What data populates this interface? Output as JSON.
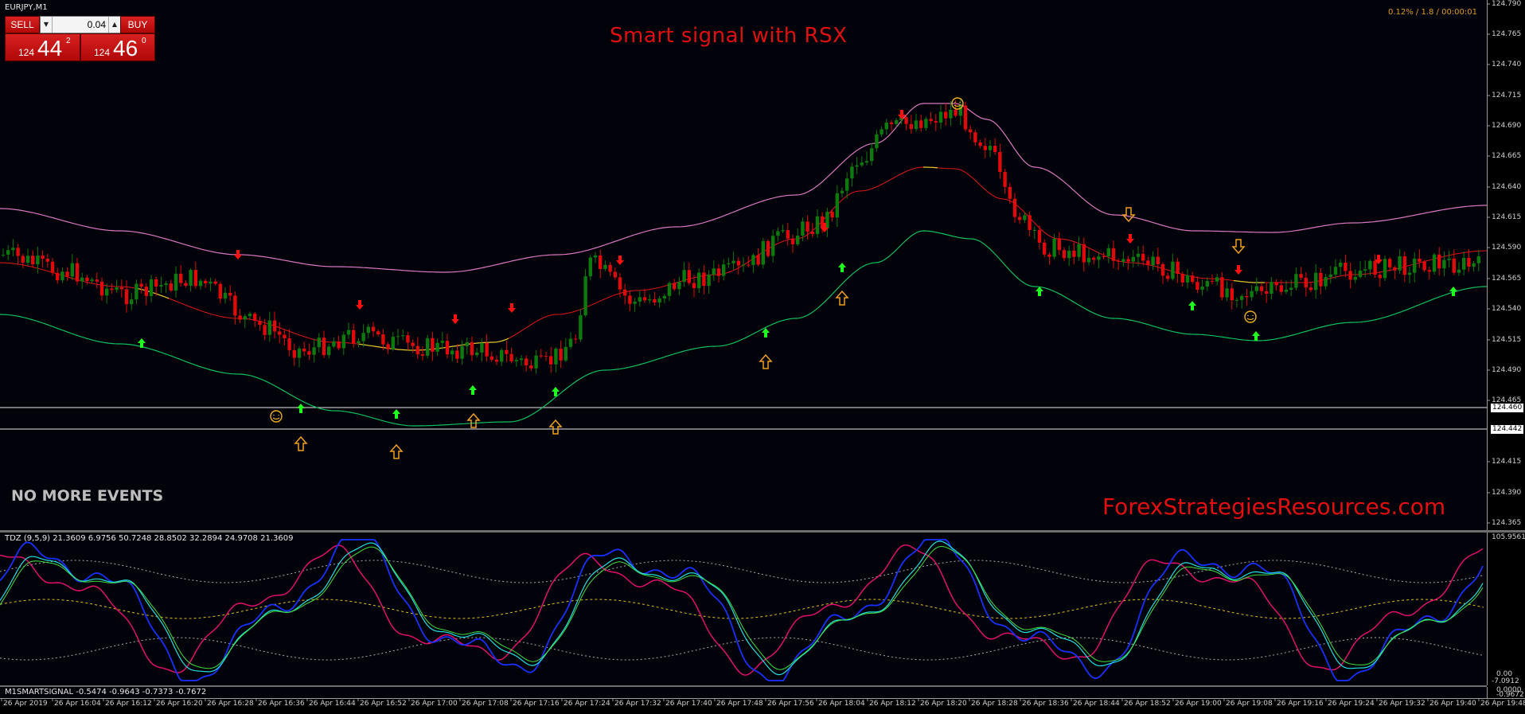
{
  "chart": {
    "symbol": "EURJPY,M1",
    "title": "Smart signal with  RSX",
    "no_events": "NO MORE EVENTS",
    "watermark": "ForexStrategiesResources.com",
    "spread_info": "0.12% / 1.8 / 00:00:01"
  },
  "trade_panel": {
    "sell_label": "SELL",
    "buy_label": "BUY",
    "lot_value": "0.04",
    "bid_prefix": "124",
    "bid_big": "44",
    "bid_sup": "2",
    "ask_prefix": "124",
    "ask_big": "46",
    "ask_sup": "0"
  },
  "indicator": {
    "tdz_label": "TDZ (9,5,9) 21.3609 6.9756 50.7248 28.8502 32.2894 24.9708 21.3609",
    "m1_label": "M1SMARTSIGNAL -0.5474 -0.9643 -0.7373 -0.7672",
    "tdz_max": "105.9561",
    "tdz_zero": "0.00",
    "tdz_low": "-7.0912",
    "m1_a": "0.0000",
    "m1_b": "-0.9672"
  },
  "price_axis": {
    "labels": [
      "124.790",
      "124.765",
      "124.740",
      "124.715",
      "124.690",
      "124.665",
      "124.640",
      "124.615",
      "124.590",
      "124.565",
      "124.540",
      "124.515",
      "124.490",
      "124.465",
      "124.415",
      "124.390",
      "124.365"
    ],
    "line_a": "124.460",
    "line_b": "124.442"
  },
  "time_axis": {
    "labels": [
      "26 Apr 2019",
      "26 Apr 16:04",
      "26 Apr 16:12",
      "26 Apr 16:20",
      "26 Apr 16:28",
      "26 Apr 16:36",
      "26 Apr 16:44",
      "26 Apr 16:52",
      "26 Apr 17:00",
      "26 Apr 17:08",
      "26 Apr 17:16",
      "26 Apr 17:24",
      "26 Apr 17:32",
      "26 Apr 17:40",
      "26 Apr 17:48",
      "26 Apr 17:56",
      "26 Apr 18:04",
      "26 Apr 18:12",
      "26 Apr 18:20",
      "26 Apr 18:28",
      "26 Apr 18:36",
      "26 Apr 18:44",
      "26 Apr 18:52",
      "26 Apr 19:00",
      "26 Apr 19:08",
      "26 Apr 19:16",
      "26 Apr 19:24",
      "26 Apr 19:32",
      "26 Apr 19:40",
      "26 Apr 19:48"
    ]
  },
  "colors": {
    "bull": "#0c7a0c",
    "bear": "#e00a0a",
    "upper_band": "#d878c0",
    "lower_band": "#10c060",
    "mid_line": "#e01818",
    "mid_flat": "#d8c830",
    "up_arrow": "#20ff20",
    "down_arrow": "#ff1010",
    "hollow_arrow": "#f0a020",
    "smiley": "#f0b020"
  }
}
